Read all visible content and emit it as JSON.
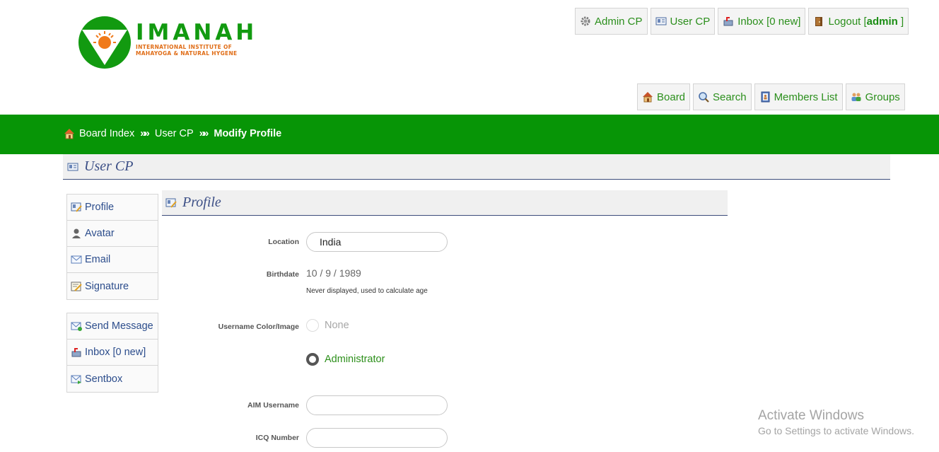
{
  "logo": {
    "word": "IMANAH",
    "subtitle_line1": "INTERNATIONAL INSTITUTE OF",
    "subtitle_line2": "MAHAYOGA & NATURAL HYGENE",
    "green": "#129a10",
    "orange": "#e06d17"
  },
  "top_links": {
    "admin_cp": "Admin CP",
    "user_cp": "User CP",
    "inbox": "Inbox [0 new]",
    "logout_prefix": "Logout [",
    "logout_user": "admin",
    "logout_suffix": " ]"
  },
  "nav_links": {
    "board": "Board",
    "search": "Search",
    "members_list": "Members List",
    "groups": "Groups"
  },
  "breadcrumb": {
    "items": [
      "Board Index",
      "User CP",
      "Modify Profile"
    ],
    "separator": "»»"
  },
  "section": {
    "title": "User CP"
  },
  "sidebar": {
    "group1": [
      "Profile",
      "Avatar",
      "Email",
      "Signature"
    ],
    "group2": [
      "Send Message",
      "Inbox [0 new]",
      "Sentbox"
    ]
  },
  "profile": {
    "title": "Profile",
    "location_label": "Location",
    "location_value": "India",
    "birthdate_label": "Birthdate",
    "birthdate_value": "10 / 9 / 1989",
    "birthdate_hint": "Never displayed, used to calculate age",
    "username_color_label": "Username Color/Image",
    "option_none": "None",
    "option_admin": "Administrator",
    "aim_label": "AIM Username",
    "aim_value": "",
    "icq_label": "ICQ Number",
    "icq_value": ""
  },
  "watermark": {
    "line1": "Activate Windows",
    "line2": "Go to Settings to activate Windows."
  },
  "colors": {
    "green_bar": "#079506",
    "link_green": "#2b8f1c",
    "heading_blue": "#3c4f86"
  }
}
